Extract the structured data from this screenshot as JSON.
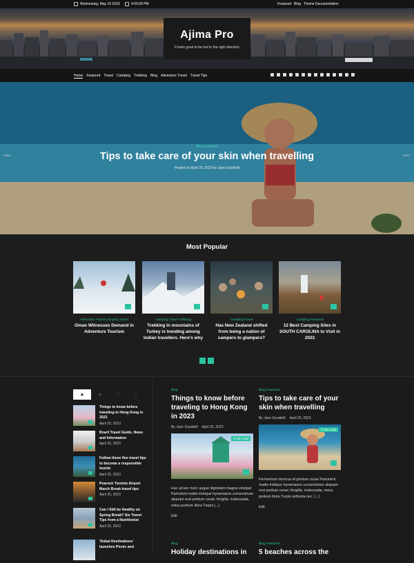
{
  "topbar": {
    "date": "Wednesday, May 10 2023",
    "time": "4:09:09 PM",
    "links": [
      "Featured",
      "Blog",
      "Theme Documentation"
    ]
  },
  "site": {
    "title": "Ajima Pro",
    "tagline": "It feels good to be lost in the right direction"
  },
  "nav": {
    "items": [
      "Home",
      "Featured",
      "Travel",
      "Camping",
      "Trekking",
      "Blog",
      "Adventure Travel",
      "Travel Tips"
    ],
    "social_icons": [
      "facebook-icon",
      "twitter-icon",
      "instagram-icon",
      "linkedin-icon",
      "youtube-icon",
      "pinterest-icon",
      "vk-icon",
      "reddit-icon",
      "whatsapp-icon",
      "spotify-icon",
      "rss-icon",
      "shuffle-icon",
      "dark-mode-icon",
      "search-icon"
    ]
  },
  "hero": {
    "category": "Blog  Featured",
    "title": "Tips to take care of your skin when travelling",
    "meta": "Posted on April 25, 2023 by Jane Goodwill",
    "prev": "PREV",
    "next": "NEXT"
  },
  "popular": {
    "heading": "Most Popular",
    "cards": [
      {
        "category": "Adventure Travel  Camping  Travel",
        "title": "Oman Witnesses Demand in Adventure Tourism"
      },
      {
        "category": "Camping  Travel  Trekking",
        "title": "Trekking in mountains of Turkey is trending among Indian travellers. Here's why"
      },
      {
        "category": "Camping  Travel",
        "title": "Has New Zealand shifted from being a nation of campers to glampers?"
      },
      {
        "category": "Camping  Featured",
        "title": "12 Best Camping Sites in SOUTH CAROLINA to Visit in 2023"
      }
    ]
  },
  "sidebar": {
    "items": [
      {
        "title": "Things to know before traveling to Hong Kong in 2023",
        "date": "April 25, 2023"
      },
      {
        "title": "Brazil Travel Guide, News and Information",
        "date": "April 25, 2023"
      },
      {
        "title": "Follow these five travel tips to become a responsible tourist",
        "date": "April 25, 2023"
      },
      {
        "title": "Pearson Toronto Airport March Break travel tips",
        "date": "April 25, 2023"
      },
      {
        "title": "Can I Still be Healthy on Spring Break? Six Travel Tips from a Nutritionist",
        "date": "April 25, 2023"
      },
      {
        "title": "'Dubai Destinations' launches Picnic and",
        "date": ""
      }
    ]
  },
  "posts": [
    {
      "category": "Blog",
      "title": "Things to know before traveling to Hong Kong in 2023",
      "author": "By Jane Goodwill",
      "date": "April 25, 2023",
      "read": "5 min read",
      "excerpt": "Hac ad per nunc augue dignissim magna volutpat Parturient mattis tristique hymenaeos consectetuer aliquam erat pretium curae; fringilla, malesuada, netus pretium litora Turpis [...]",
      "edit": "Edit"
    },
    {
      "category": "Blog  Featured",
      "title": "Tips to take care of your skin when travelling",
      "author": "By Jane Goodwill",
      "date": "April 25, 2023",
      "read": "5 min read",
      "excerpt": "Fermentum rhoncus id pretium curae Parturient mattis tristique hymenaeos consectetuer aliquam erat pretium curae; fringilla, malesuada, netus pretium litora Turpis vehicula nec. [...]",
      "edit": "Edit"
    },
    {
      "category": "Blog",
      "title": "Holiday destinations in"
    },
    {
      "category": "Blog  Featured",
      "title": "5 beaches across the"
    }
  ],
  "colors": {
    "accent": "#2bc4a3",
    "background": "#1b1b1b"
  }
}
